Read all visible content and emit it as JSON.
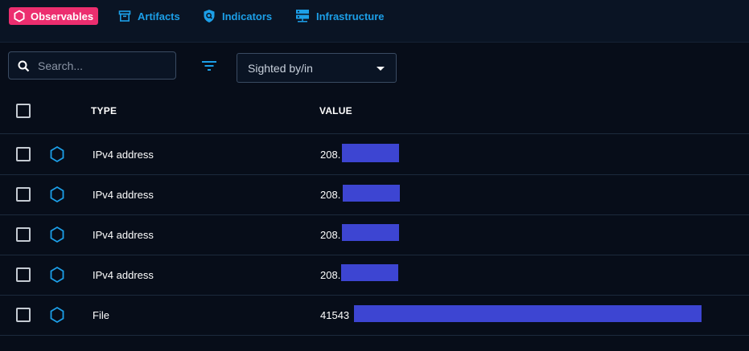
{
  "tabs": [
    {
      "label": "Observables",
      "icon": "hexagon-icon",
      "active": true
    },
    {
      "label": "Artifacts",
      "icon": "archive-icon",
      "active": false
    },
    {
      "label": "Indicators",
      "icon": "shield-search-icon",
      "active": false
    },
    {
      "label": "Infrastructure",
      "icon": "server-icon",
      "active": false
    }
  ],
  "search": {
    "placeholder": "Search..."
  },
  "filter": {
    "icon": "filter-icon"
  },
  "sighting_select": {
    "value": "Sighted by/in"
  },
  "table": {
    "columns": [
      "TYPE",
      "VALUE"
    ],
    "rows": [
      {
        "type": "IPv4 address",
        "value": "208."
      },
      {
        "type": "IPv4 address",
        "value": "208."
      },
      {
        "type": "IPv4 address",
        "value": "208."
      },
      {
        "type": "IPv4 address",
        "value": "208."
      },
      {
        "type": "File",
        "value": "41543"
      }
    ]
  },
  "colors": {
    "accent": "#1c9fe8",
    "active_tab": "#ec2e6f",
    "redaction": "#3d45d2",
    "background": "#070d19"
  }
}
